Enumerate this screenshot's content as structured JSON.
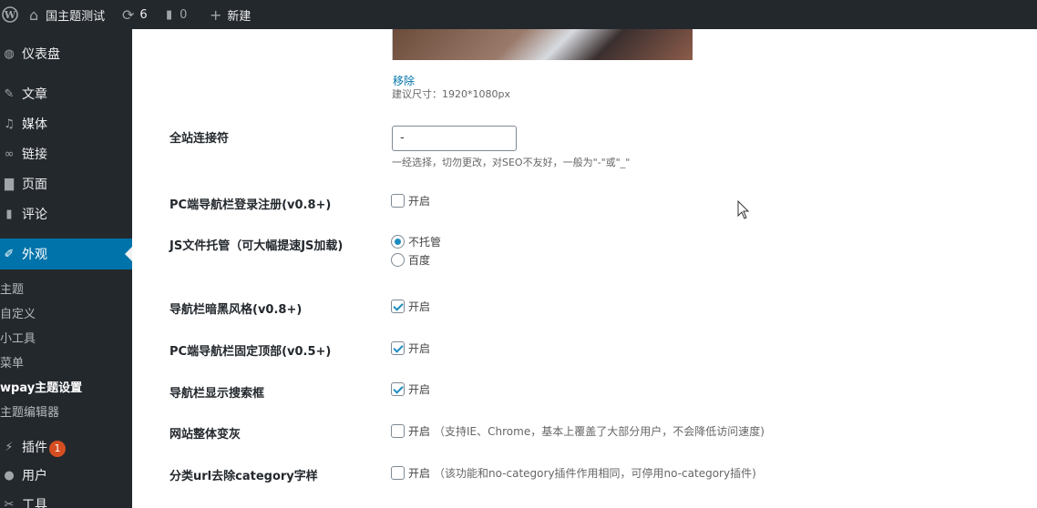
{
  "adminbar": {
    "wp_logo_icon": "wordpress-logo-icon",
    "site_name": "国主题测试",
    "updates_count": "6",
    "comments_count": "0",
    "new_label": "新建"
  },
  "sidebar": {
    "items": [
      {
        "icon": "dashboard-icon",
        "label": "仪表盘"
      },
      {
        "icon": "pin-icon",
        "label": "文章"
      },
      {
        "icon": "media-icon",
        "label": "媒体"
      },
      {
        "icon": "link-icon",
        "label": "链接"
      },
      {
        "icon": "page-icon",
        "label": "页面"
      },
      {
        "icon": "comment-icon",
        "label": "评论"
      },
      {
        "icon": "appearance-icon",
        "label": "外观"
      },
      {
        "icon": "plugin-icon",
        "label": "插件",
        "badge": "1"
      },
      {
        "icon": "user-icon",
        "label": "用户"
      },
      {
        "icon": "tools-icon",
        "label": "工具"
      }
    ],
    "submenu": [
      "主题",
      "自定义",
      "小工具",
      "菜单",
      "wpay主题设置",
      "主题编辑器"
    ]
  },
  "content": {
    "remove_link": "移除",
    "size_hint": "建议尺寸：1920*1080px",
    "settings": [
      {
        "label": "全站连接符",
        "input_value": "-",
        "hint": "一经选择，切勿更改，对SEO不友好，一般为\"-\"或\"_\""
      },
      {
        "label": "PC端导航栏登录注册(v0.8+)",
        "option": "开启",
        "checked": false
      },
      {
        "label": "JS文件托管（可大幅提速JS加载)",
        "radios": [
          "不托管",
          "百度"
        ],
        "selected": "不托管"
      },
      {
        "label": "导航栏暗黑风格(v0.8+)",
        "option": "开启",
        "checked": true
      },
      {
        "label": "PC端导航栏固定顶部(v0.5+)",
        "option": "开启",
        "checked": true
      },
      {
        "label": "导航栏显示搜索框",
        "option": "开启",
        "checked": true
      },
      {
        "label": "网站整体变灰",
        "option": "开启",
        "note": "（支持IE、Chrome，基本上覆盖了大部分用户，不会降低访问速度)",
        "checked": false
      },
      {
        "label": "分类url去除category字样",
        "option": "开启",
        "note": "（该功能和no-category插件作用相同，可停用no-category插件)",
        "checked": false
      }
    ]
  },
  "colors": {
    "adminbar_bg": "#23282d",
    "accent": "#0073aa",
    "checkmark": "#1e8cbe",
    "badge": "#d54e21"
  }
}
